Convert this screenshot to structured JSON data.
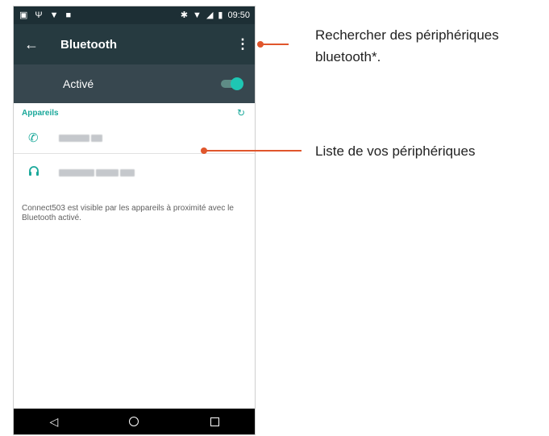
{
  "status_bar": {
    "time": "09:50",
    "left_icons": [
      "image-icon",
      "usb-icon",
      "wifi-icon",
      "notification-icon"
    ],
    "right_icons": [
      "bluetooth-icon",
      "wifi-icon",
      "signal-icon",
      "battery-icon"
    ]
  },
  "toolbar": {
    "title": "Bluetooth"
  },
  "switch": {
    "label": "Activé",
    "state": "on"
  },
  "devices_section": {
    "header": "Appareils",
    "devices": [
      {
        "icon": "phone-icon",
        "name_blurred": true
      },
      {
        "icon": "headphones-icon",
        "name_blurred": true
      }
    ]
  },
  "footer_note": "Connect503 est visible par les appareils à proximité avec le Bluetooth activé.",
  "annotations": {
    "menu_note": "Rechercher des périphériques bluetooth*.",
    "list_note": "Liste de vos périphériques"
  },
  "colors": {
    "accent": "#1aa89a",
    "toolbar": "#263a40",
    "switchbar": "#37474f",
    "callout": "#e0562c"
  }
}
